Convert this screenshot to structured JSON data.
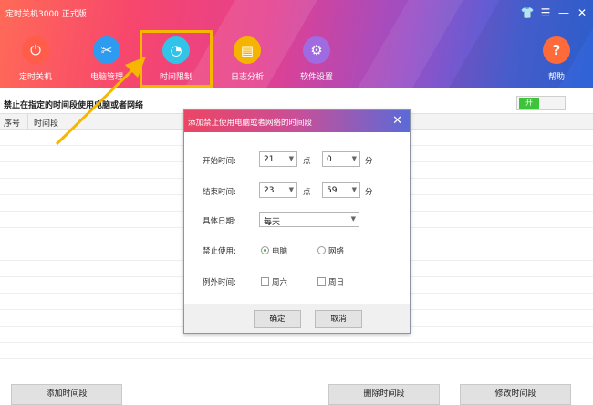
{
  "window": {
    "title": "定时关机3000 正式版",
    "controls": [
      {
        "icon": "shirt-icon",
        "glyph": "👕"
      },
      {
        "icon": "menu-icon",
        "glyph": "☰"
      },
      {
        "icon": "minimize-icon",
        "glyph": "—"
      },
      {
        "icon": "close-icon",
        "glyph": "✕"
      }
    ]
  },
  "toolbar": {
    "items": [
      {
        "label": "定时关机",
        "icon": "power-icon",
        "glyph": "⏻",
        "color": "#ff5c4a"
      },
      {
        "label": "电脑管理",
        "icon": "tools-icon",
        "glyph": "✂",
        "color": "#2f9bf0"
      },
      {
        "label": "时间限制",
        "icon": "timer-icon",
        "glyph": "◔",
        "color": "#32c3e8",
        "active": true
      },
      {
        "label": "日志分析",
        "icon": "log-icon",
        "glyph": "▤",
        "color": "#f5b400"
      },
      {
        "label": "软件设置",
        "icon": "settings-icon",
        "glyph": "⚙",
        "color": "#a06ae0"
      }
    ],
    "help": {
      "label": "帮助",
      "icon": "help-icon",
      "glyph": "?",
      "color": "#ff6a3a"
    }
  },
  "list": {
    "title": "禁止在指定的时间段使用电脑或者网络",
    "toggle_label": "开",
    "columns": [
      "序号",
      "时间段"
    ]
  },
  "bottom_buttons": {
    "add": "添加时间段",
    "delete": "删除时间段",
    "edit": "修改时间段"
  },
  "dialog": {
    "title": "添加禁止使用电脑或者网络的时间段",
    "start_time": {
      "label": "开始时间:",
      "hour": "21",
      "hour_unit": "点",
      "minute": "0",
      "minute_unit": "分"
    },
    "end_time": {
      "label": "结束时间:",
      "hour": "23",
      "hour_unit": "点",
      "minute": "59",
      "minute_unit": "分"
    },
    "date": {
      "label": "具体日期:",
      "value": "每天"
    },
    "forbid": {
      "label": "禁止使用:",
      "options": [
        "电脑",
        "网络"
      ],
      "selected": "电脑"
    },
    "exception": {
      "label": "例外时间:",
      "options": [
        "周六",
        "周日"
      ]
    },
    "ok": "确定",
    "cancel": "取消"
  },
  "colors": {
    "accent_green": "#3ec43a",
    "highlight_border": "#f5b700"
  }
}
